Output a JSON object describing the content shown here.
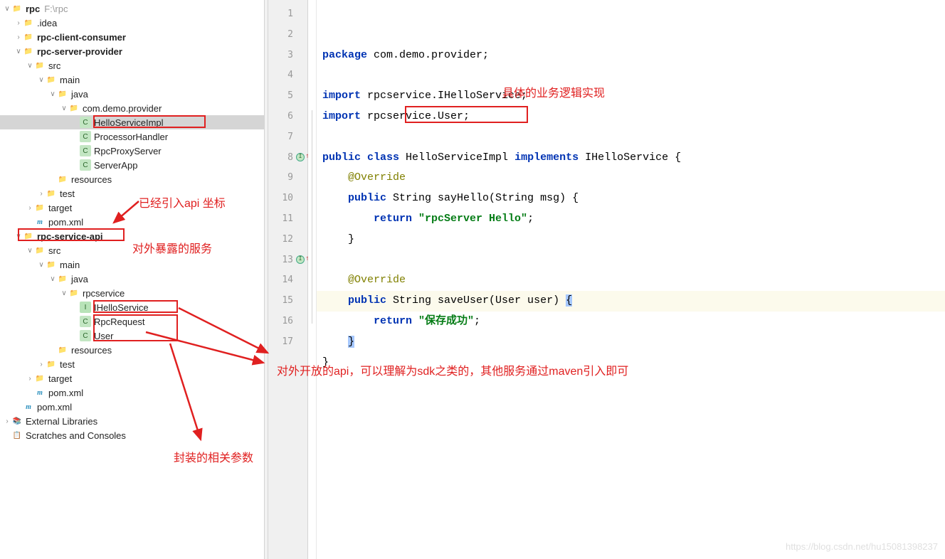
{
  "tree": {
    "root": {
      "name": "rpc",
      "path": "F:\\rpc"
    },
    "idea": ".idea",
    "consumer": "rpc-client-consumer",
    "provider": "rpc-server-provider",
    "src": "src",
    "main": "main",
    "java": "java",
    "pkg_provider": "com.demo.provider",
    "hello_impl": "HelloServiceImpl",
    "proc_handler": "ProcessorHandler",
    "proxy_server": "RpcProxyServer",
    "server_app": "ServerApp",
    "resources": "resources",
    "test": "test",
    "target": "target",
    "pom": "pom.xml",
    "api": "rpc-service-api",
    "pkg_rpc": "rpcservice",
    "ihello": "IHelloService",
    "rpcreq": "RpcRequest",
    "user": "User",
    "ext_lib": "External Libraries",
    "scratch": "Scratches and Consoles"
  },
  "code": {
    "l1a": "package",
    "l1b": " com.demo.provider;",
    "l3a": "import",
    "l3b": " rpcservice.IHelloService;",
    "l4a": "import",
    "l4b": " rpcservice.User;",
    "l6a": "public class ",
    "l6b": "HelloServiceImpl",
    "l6c": " implements ",
    "l6d": "IHelloService {",
    "l7": "    @Override",
    "l8a": "    public ",
    "l8b": "String sayHello(String msg) {",
    "l9a": "        return ",
    "l9b": "\"rpcServer Hello\"",
    "l9c": ";",
    "l10": "    }",
    "l12": "    @Override",
    "l13a": "    public ",
    "l13b": "String saveUser(User user) ",
    "l13c": "{",
    "l14a": "        return ",
    "l14b": "\"保存成功\"",
    "l14c": ";",
    "l15": "    ",
    "l15b": "}",
    "l16": "}"
  },
  "annotations": {
    "a1": "具体的业务逻辑实现",
    "a2": "已经引入api 坐标",
    "a3": "对外暴露的服务",
    "a4": "对外开放的api，可以理解为sdk之类的，其他服务通过maven引入即可",
    "a5": "封装的相关参数"
  },
  "lines": [
    "1",
    "2",
    "3",
    "4",
    "5",
    "6",
    "7",
    "8",
    "9",
    "10",
    "11",
    "12",
    "13",
    "14",
    "15",
    "16",
    "17"
  ],
  "watermark": "https://blog.csdn.net/hu15081398237"
}
